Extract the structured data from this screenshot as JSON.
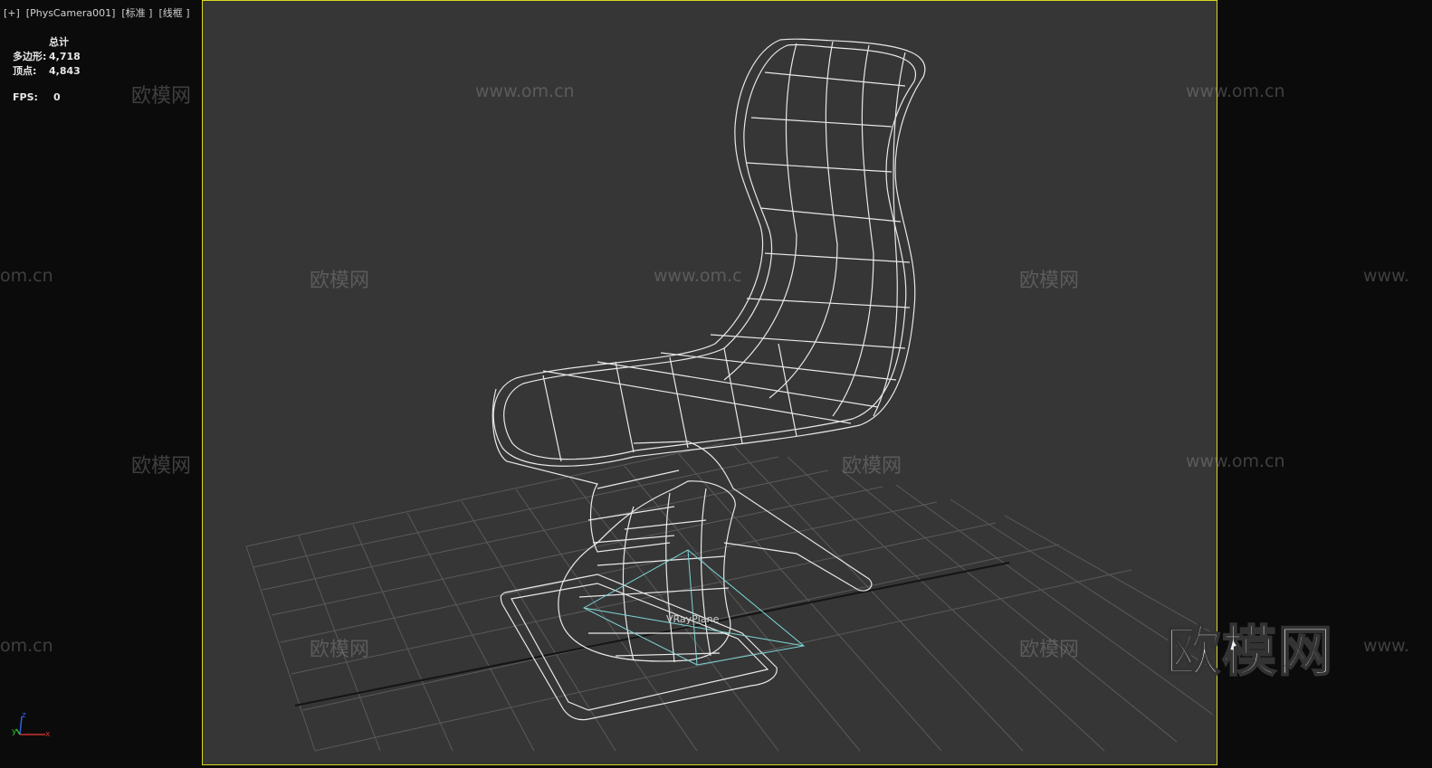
{
  "viewport": {
    "label": "[+]  [PhysCamera001]  [标准 ]  [线框 ]"
  },
  "stats": {
    "header": "总计",
    "polygons_label": "多边形:",
    "polygons_value": "4,718",
    "vertices_label": "顶点:",
    "vertices_value": "4,843",
    "fps_label": "FPS:",
    "fps_value": "0"
  },
  "scene": {
    "object_label": "VRayPlane",
    "wireframe_color": "#e8e8e8",
    "plane_color": "#7fd6d6",
    "grid_color": "#5a5a5a",
    "safe_frame_color": "#d8d820"
  },
  "watermarks": {
    "cn": "欧模网",
    "url": "www.om.cn",
    "url_partial_left": "om.cn",
    "url_partial_right": "www.",
    "url_partial_mid": "www.om.c"
  },
  "logo": {
    "text": "欧模网"
  },
  "gizmo": {
    "x": "x",
    "y": "y",
    "z": "z"
  }
}
